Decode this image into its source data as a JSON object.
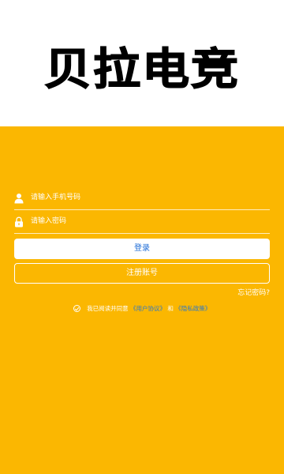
{
  "brand": {
    "logo_text": "贝拉电竞"
  },
  "login_form": {
    "phone_placeholder": "请输入手机号码",
    "password_placeholder": "请输入密码",
    "login_button": "登录",
    "register_button": "注册账号",
    "forgot_password": "忘记密码?"
  },
  "agreement": {
    "prefix": "我已阅读并同意",
    "user_agreement": "《用户协议》",
    "and": "和",
    "privacy_policy": "《隐私政策》"
  },
  "icons": {
    "phone": "user-icon",
    "password": "lock-icon",
    "checkbox": "check-circle-icon"
  },
  "colors": {
    "panel_background": "#fbb701",
    "login_text": "#1d6bd6",
    "link": "#2e78c8"
  }
}
